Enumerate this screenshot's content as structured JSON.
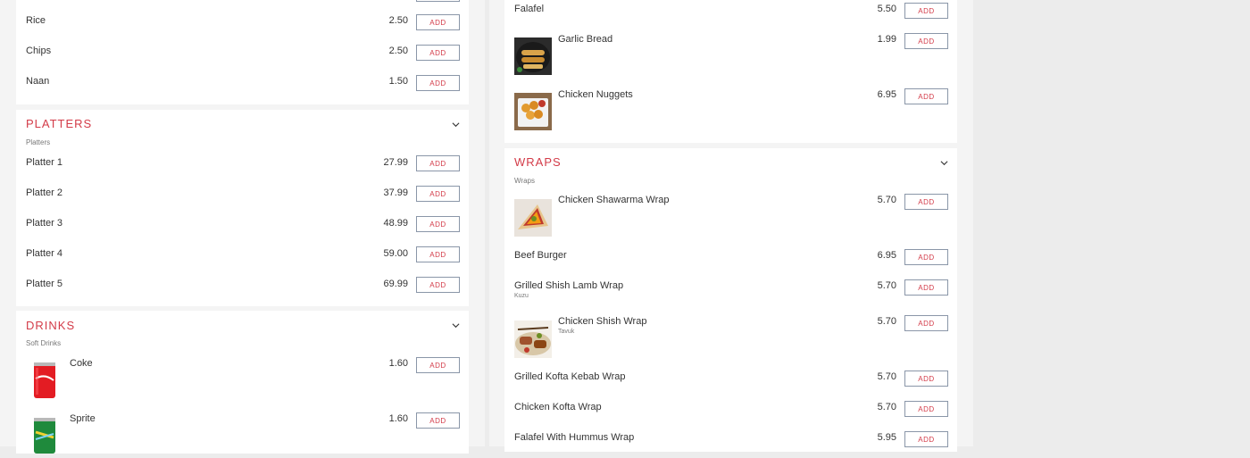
{
  "add_label": "Add",
  "colors": {
    "accent": "#d33b48",
    "button_border": "#8a96a8"
  },
  "left": {
    "sides": [
      {
        "name": "Rice",
        "price": "2.50"
      },
      {
        "name": "Chips",
        "price": "2.50"
      },
      {
        "name": "Naan",
        "price": "1.50"
      }
    ],
    "platters": {
      "title": "Platters",
      "subcategory": "Platters",
      "items": [
        {
          "name": "Platter 1",
          "price": "27.99"
        },
        {
          "name": "Platter 2",
          "price": "37.99"
        },
        {
          "name": "Platter 3",
          "price": "48.99"
        },
        {
          "name": "Platter 4",
          "price": "59.00"
        },
        {
          "name": "Platter 5",
          "price": "69.99"
        }
      ]
    },
    "drinks": {
      "title": "Drinks",
      "subcategory": "Soft Drinks",
      "items": [
        {
          "name": "Coke",
          "price": "1.60"
        },
        {
          "name": "Sprite",
          "price": "1.60"
        }
      ]
    }
  },
  "right": {
    "sides": [
      {
        "name": "Falafel",
        "price": "5.50"
      },
      {
        "name": "Garlic Bread",
        "price": "1.99"
      },
      {
        "name": "Chicken Nuggets",
        "price": "6.95"
      }
    ],
    "wraps": {
      "title": "Wraps",
      "subcategory": "Wraps",
      "items": [
        {
          "name": "Chicken Shawarma Wrap",
          "price": "5.70"
        },
        {
          "name": "Beef Burger",
          "price": "6.95"
        },
        {
          "name": "Grilled Shish Lamb Wrap",
          "sub": "Kuzu",
          "price": "5.70"
        },
        {
          "name": "Chicken Shish Wrap",
          "sub": "Tavuk",
          "price": "5.70"
        },
        {
          "name": "Grilled Kofta Kebab Wrap",
          "price": "5.70"
        },
        {
          "name": "Chicken Kofta Wrap",
          "price": "5.70"
        },
        {
          "name": "Falafel With Hummus Wrap",
          "price": "5.95"
        }
      ]
    }
  }
}
